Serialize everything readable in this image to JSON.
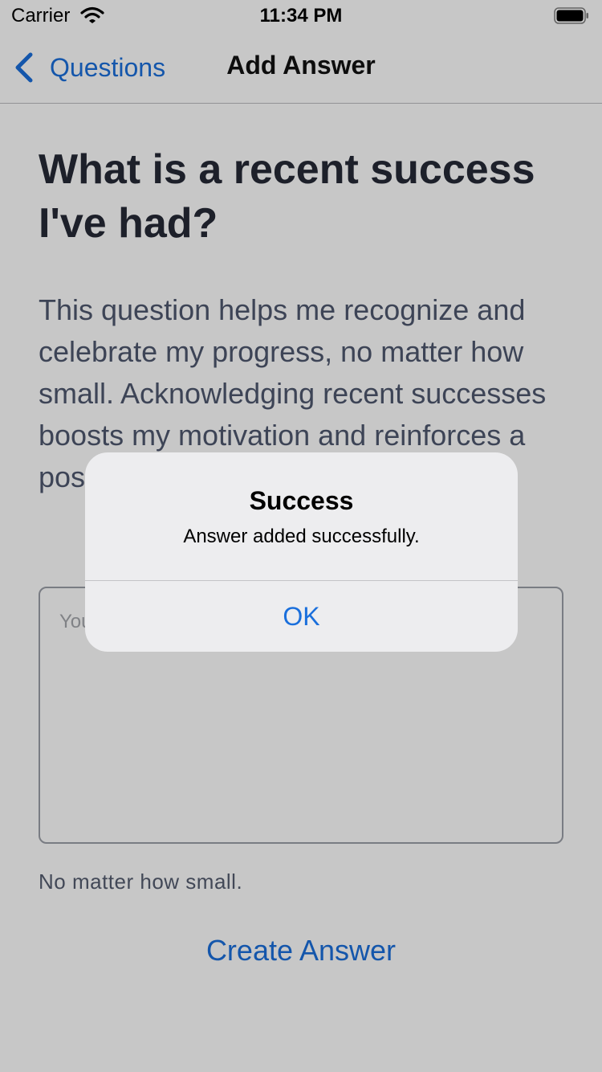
{
  "status_bar": {
    "carrier": "Carrier",
    "time": "11:34 PM",
    "wifi_icon": "wifi-icon",
    "battery_icon": "battery-full-icon"
  },
  "nav": {
    "back_label": "Questions",
    "back_icon": "chevron-left-icon",
    "title": "Add Answer"
  },
  "question": {
    "title": "What is a recent success I've had?",
    "description": "This question helps me recognize and celebrate my progress, no matter how small. Acknowledging recent successes boosts my motivation and reinforces a positive mindset."
  },
  "answer": {
    "placeholder": "Your answer",
    "hint": "No matter how small."
  },
  "create_button": "Create Answer",
  "alert": {
    "title": "Success",
    "message": "Answer added successfully.",
    "ok_label": "OK"
  },
  "colors": {
    "accent": "#1a6fdc",
    "title_text": "#262a36",
    "body_text": "#4f586f"
  }
}
